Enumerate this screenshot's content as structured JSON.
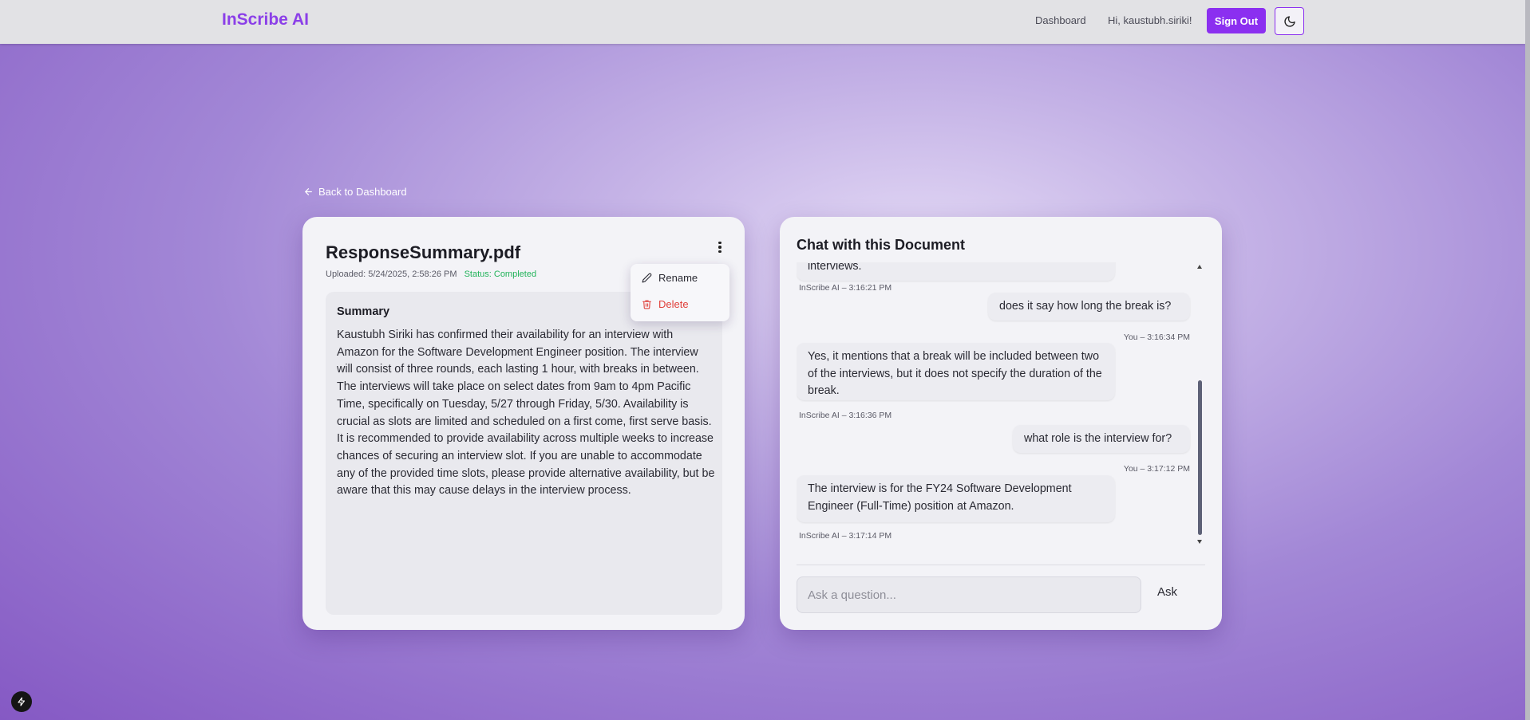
{
  "app": {
    "brand": "InScribe AI"
  },
  "nav": {
    "dashboard": "Dashboard",
    "greeting": "Hi, kaustubh.siriki!",
    "sign_out": "Sign Out",
    "theme_icon": "moon-icon"
  },
  "back_link": "Back to Dashboard",
  "document": {
    "title": "ResponseSummary.pdf",
    "uploaded": "Uploaded: 5/24/2025, 2:58:26 PM",
    "status": "Status: Completed",
    "summary_heading": "Summary",
    "summary_text": "Kaustubh Siriki has confirmed their availability for an interview with Amazon for the Software Development Engineer position. The interview will consist of three rounds, each lasting 1 hour, with breaks in between. The interviews will take place on select dates from 9am to 4pm Pacific Time, specifically on Tuesday, 5/27 through Friday, 5/30. Availability is crucial as slots are limited and scheduled on a first come, first serve basis. It is recommended to provide availability across multiple weeks to increase chances of securing an interview slot. If you are unable to accommodate any of the provided time slots, please provide alternative availability, but be aware that this may cause delays in the interview process."
  },
  "menu": {
    "rename": "Rename",
    "delete": "Delete"
  },
  "chat": {
    "title": "Chat with this Document",
    "messages": [
      {
        "role": "ai",
        "text": "interviews.",
        "stamp": "InScribe AI – 3:16:21 PM"
      },
      {
        "role": "user",
        "text": "does it say how long the break is?",
        "stamp": "You – 3:16:34 PM"
      },
      {
        "role": "ai",
        "text": "Yes, it mentions that a break will be included between two of the interviews, but it does not specify the duration of the break.",
        "stamp": "InScribe AI – 3:16:36 PM"
      },
      {
        "role": "user",
        "text": "what role is the interview for?",
        "stamp": "You – 3:17:12 PM"
      },
      {
        "role": "ai",
        "text": "The interview is for the FY24 Software Development Engineer (Full-Time) position at Amazon.",
        "stamp": "InScribe AI – 3:17:14 PM"
      }
    ],
    "input_placeholder": "Ask a question...",
    "ask": "Ask"
  },
  "colors": {
    "accent": "#8b2ff0",
    "status_green": "#22b35a",
    "delete_red": "#e0403a"
  }
}
